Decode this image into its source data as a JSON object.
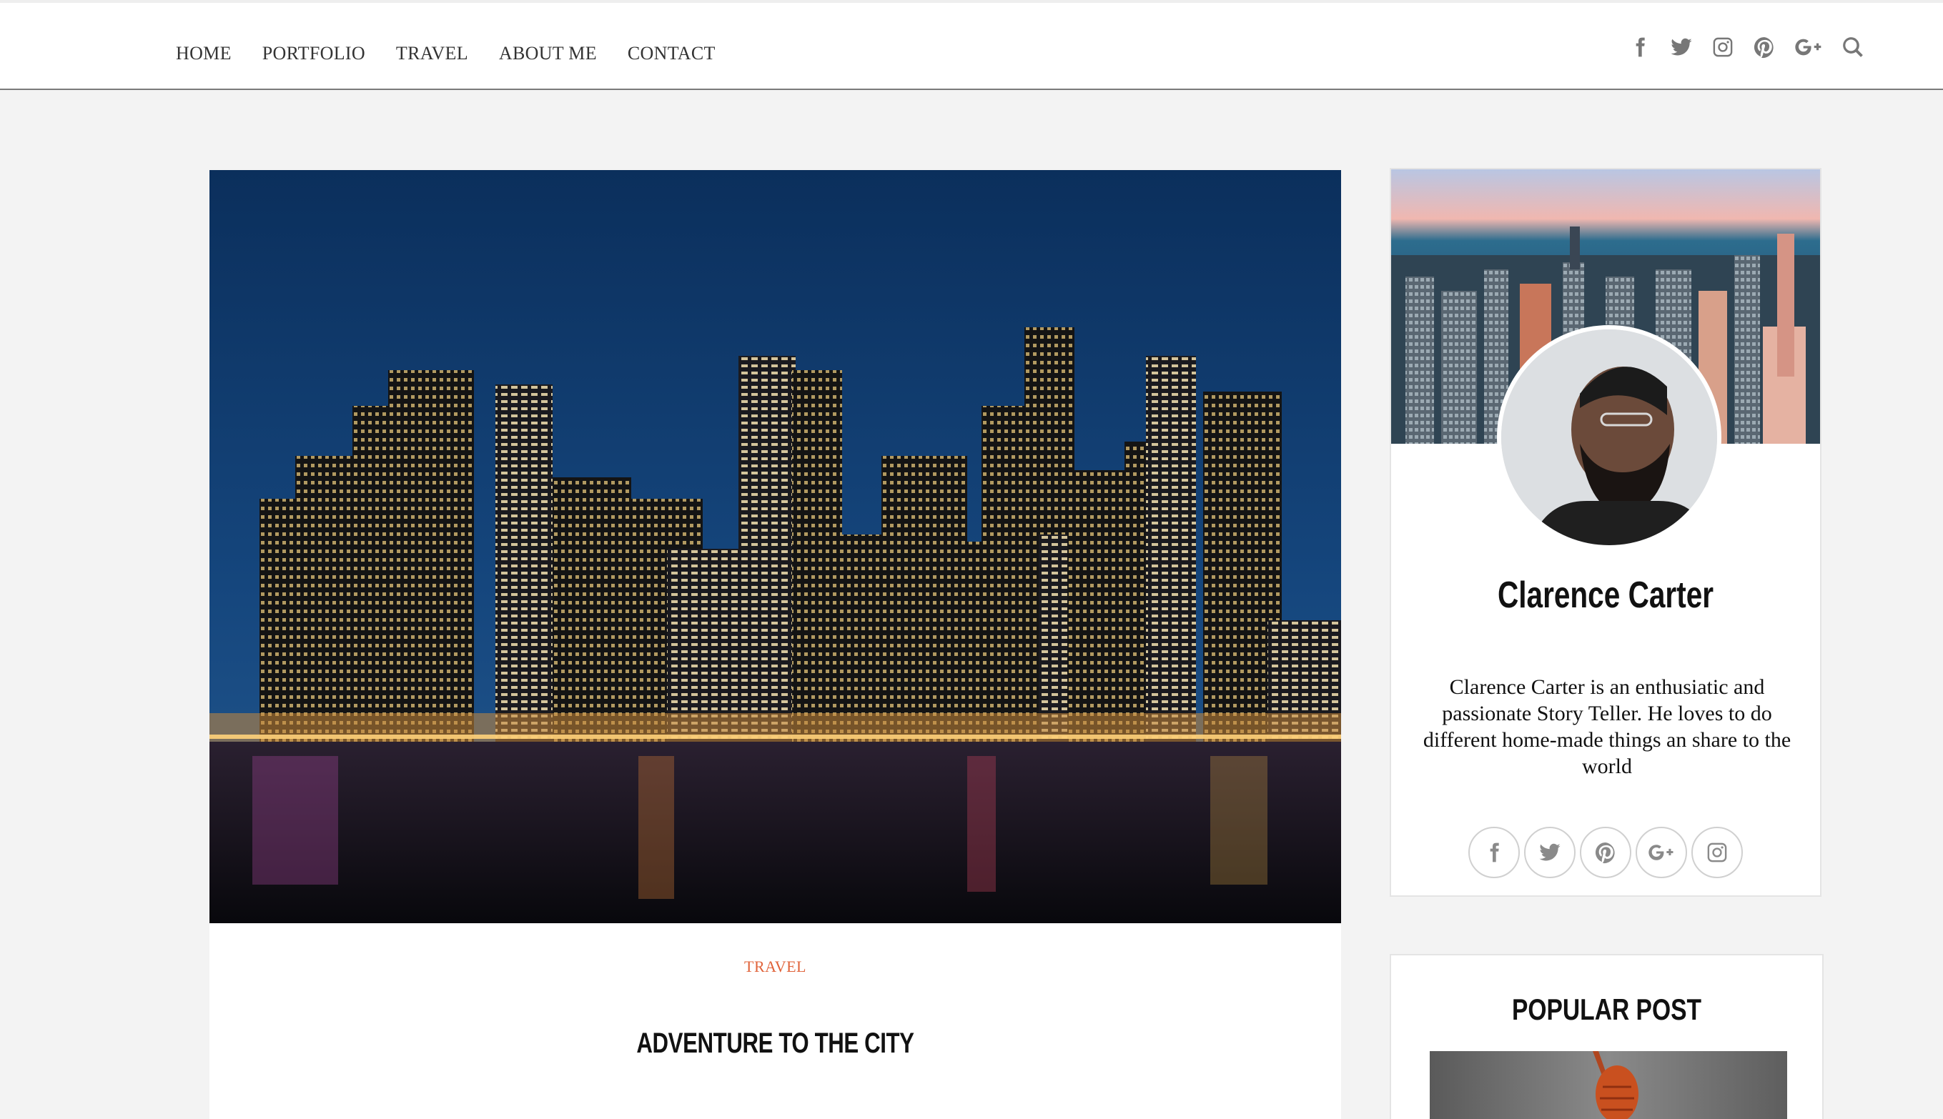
{
  "nav": {
    "items": [
      {
        "label": "HOME"
      },
      {
        "label": "PORTFOLIO"
      },
      {
        "label": "TRAVEL"
      },
      {
        "label": "ABOUT ME"
      },
      {
        "label": "CONTACT"
      }
    ],
    "social_icons": [
      "facebook-icon",
      "twitter-icon",
      "instagram-icon",
      "pinterest-icon",
      "google-plus-icon",
      "search-icon"
    ]
  },
  "post": {
    "category": "TRAVEL",
    "title": "ADVENTURE TO THE CITY",
    "image": "night-city-skyline"
  },
  "author": {
    "name": "Clarence Carter",
    "bio": "Clarence Carter is an enthusiatic and passionate Story Teller. He loves to do different home-made things an share to the world",
    "social_icons": [
      "facebook-icon",
      "twitter-icon",
      "pinterest-icon",
      "google-plus-icon",
      "instagram-icon"
    ]
  },
  "popular": {
    "title": "POPULAR POST"
  },
  "colors": {
    "accent": "#e0633a",
    "background": "#f3f3f3",
    "icon": "#777777"
  }
}
